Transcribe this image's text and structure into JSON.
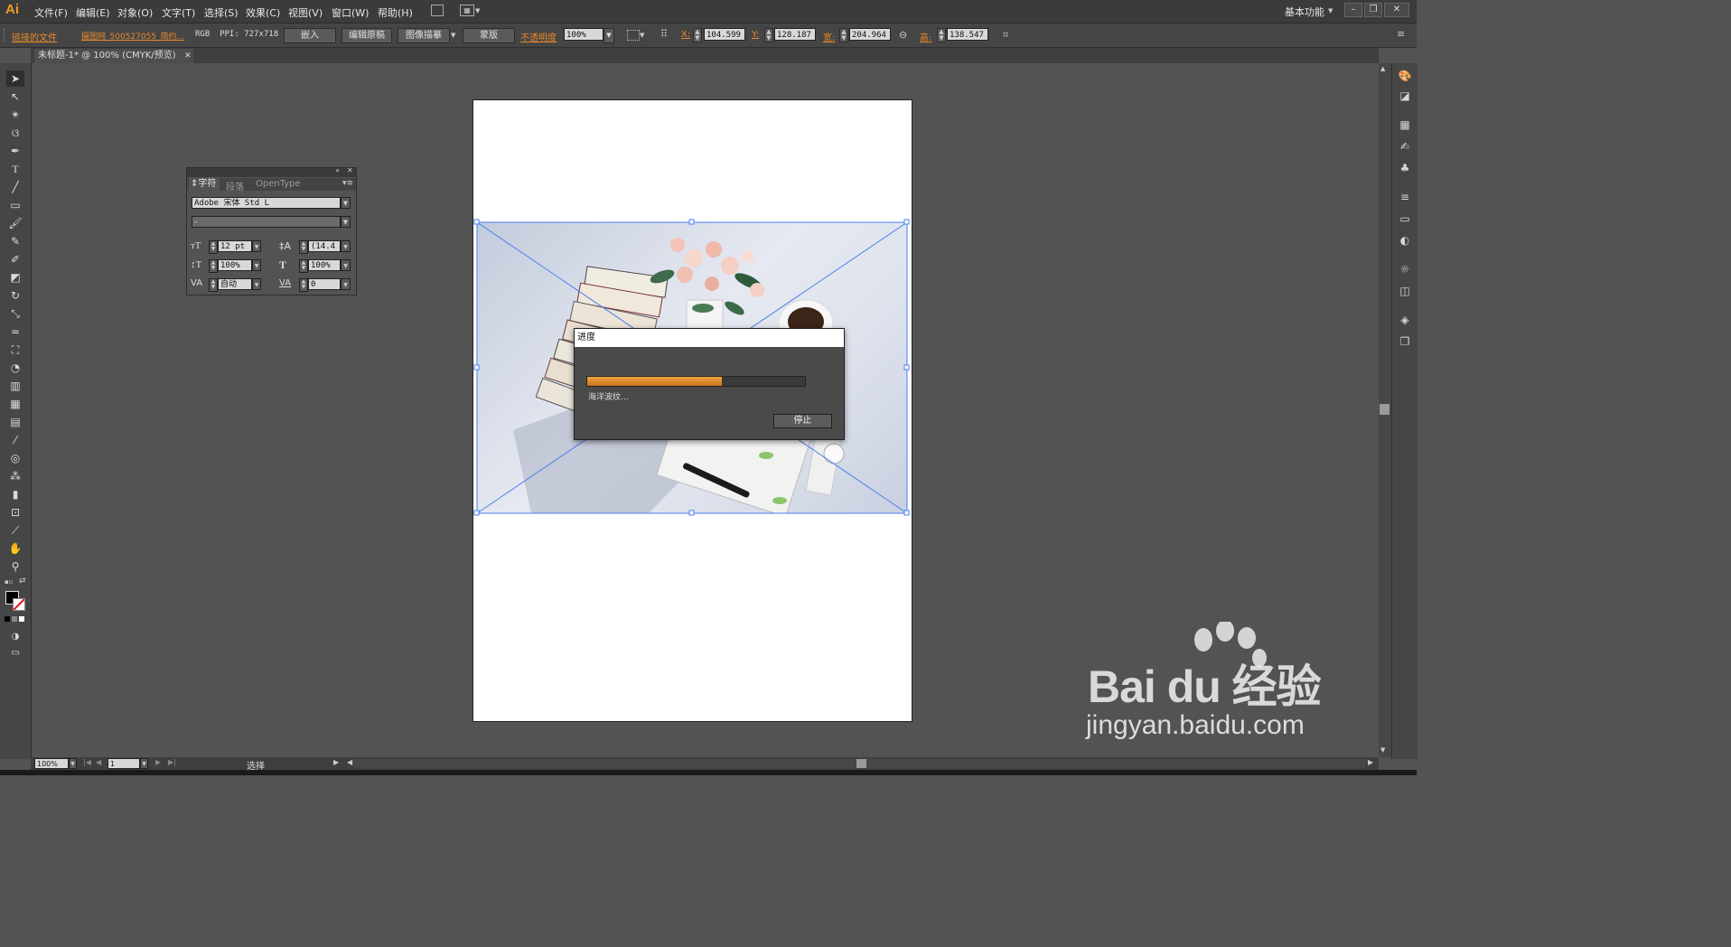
{
  "app": {
    "logo": "Ai"
  },
  "menu": [
    "文件(F)",
    "编辑(E)",
    "对象(O)",
    "文字(T)",
    "选择(S)",
    "效果(C)",
    "视图(V)",
    "窗口(W)",
    "帮助(H)"
  ],
  "workspace": "基本功能",
  "control": {
    "linked_file": "链接的文件",
    "file_name": "摄图网_500527055_简约...",
    "color_mode": "RGB  PPI: 727x718",
    "embed": "嵌入",
    "edit_original": "编辑原稿",
    "image_trace": "图像描摹",
    "mask": "蒙版",
    "opacity_label": "不透明度",
    "opacity_value": "100%",
    "x_label": "X:",
    "x_value": "104.599",
    "y_label": "Y:",
    "y_value": "128.187",
    "w_label": "宽:",
    "w_value": "204.964",
    "h_label": "高:",
    "h_value": "138.547"
  },
  "document_tab": {
    "title": "未标题-1* @ 100% (CMYK/预览)"
  },
  "char_panel": {
    "tabs": [
      "字符",
      "段落",
      "OpenType"
    ],
    "font_family": "Adobe 宋体 Std L",
    "font_style": "-",
    "font_size": "12 pt",
    "leading": "(14.4",
    "vscale": "100%",
    "hscale": "100%",
    "kerning": "自动",
    "tracking": "0"
  },
  "dialog": {
    "title": "进度",
    "message": "海洋波纹...",
    "stop": "停止",
    "progress": 0.62,
    "progress_color": "#e8892c"
  },
  "status": {
    "zoom": "100%",
    "page": "1",
    "tool": "选择"
  },
  "watermark": {
    "brand": "Bai du 经验",
    "url": "jingyan.baidu.com"
  }
}
